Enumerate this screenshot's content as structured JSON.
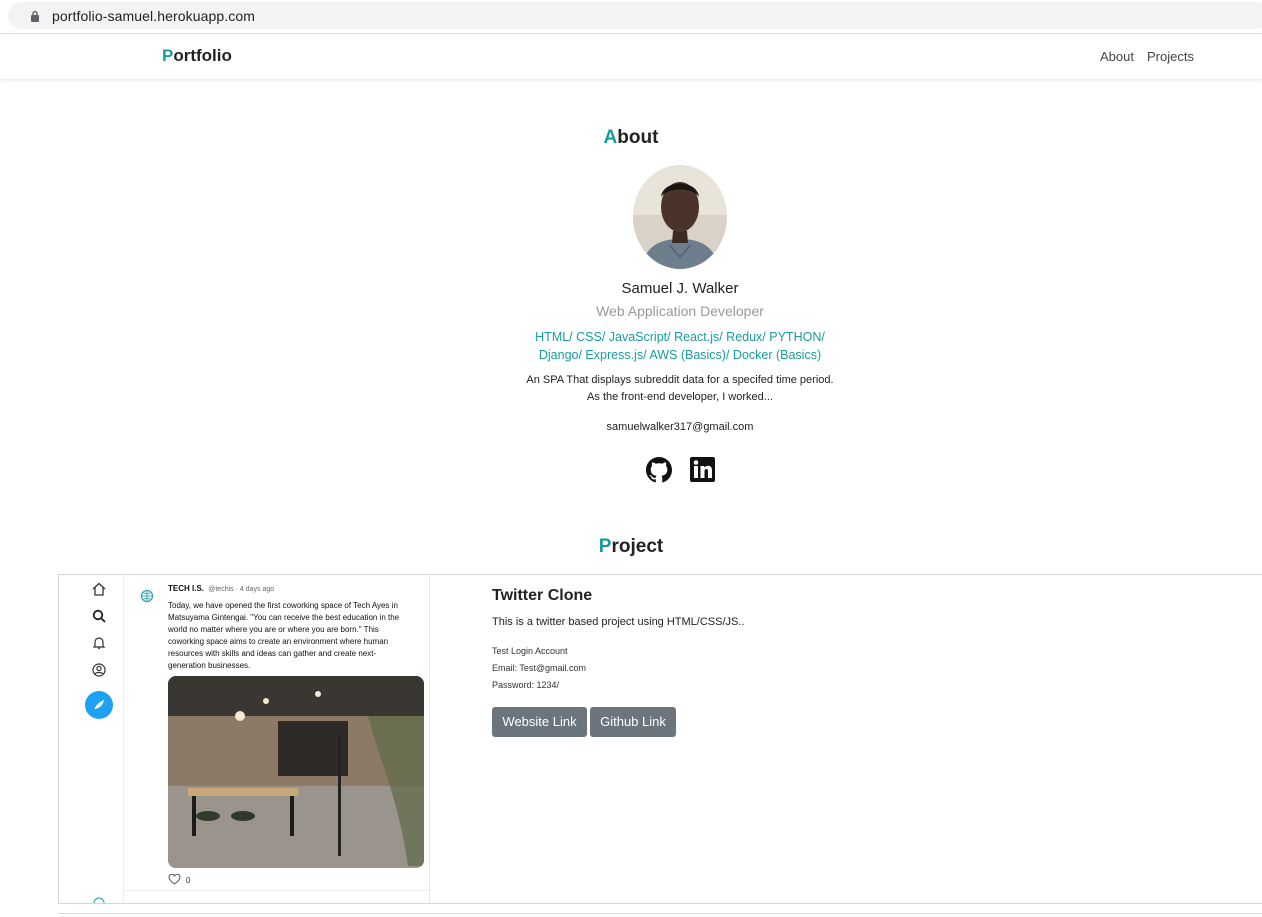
{
  "browser": {
    "url": "portfolio-samuel.herokuapp.com"
  },
  "navbar": {
    "brand_first": "P",
    "brand_rest": "ortfolio",
    "links": [
      "About",
      "Projects"
    ]
  },
  "about": {
    "title_first": "A",
    "title_rest": "bout",
    "name": "Samuel J. Walker",
    "role": "Web Application Developer",
    "skills_line1": "HTML/ CSS/ JavaScript/ React.js/ Redux/ PYTHON/",
    "skills_line2": "Django/ Express.js/ AWS (Basics)/ Docker (Basics)",
    "desc_line1": "An SPA That displays subreddit data for a specifed time period.",
    "desc_line2": "As the front-end developer, I worked...",
    "email": "samuelwalker317@gmail.com",
    "icons": [
      "github-icon",
      "linkedin-icon"
    ]
  },
  "project": {
    "title_first": "P",
    "title_rest": "roject",
    "name": "Twitter Clone",
    "description": "This is a twitter based project using HTML/CSS/JS..",
    "account_label": "Test Login Account",
    "email_line": "Email: Test@gmail.com",
    "password_line": "Password: 1234/",
    "website_button": "Website Link",
    "github_button": "Github Link",
    "screenshot": {
      "author": "TECH I.S.",
      "handle": "@techis · 4 days ago",
      "tweet_lines": [
        "Today, we have opened the first coworking space of Tech Ayes in",
        "Matsuyama Gintengai. \"You can receive the best education in the",
        "world no matter where you are or where you are born.\" This",
        "coworking space aims to create an environment where human",
        "resources with skills and ideas can gather and create next-",
        "generation businesses."
      ],
      "likes": "0"
    }
  },
  "colors": {
    "accent": "#1a9c9c",
    "button": "#6c757d"
  }
}
